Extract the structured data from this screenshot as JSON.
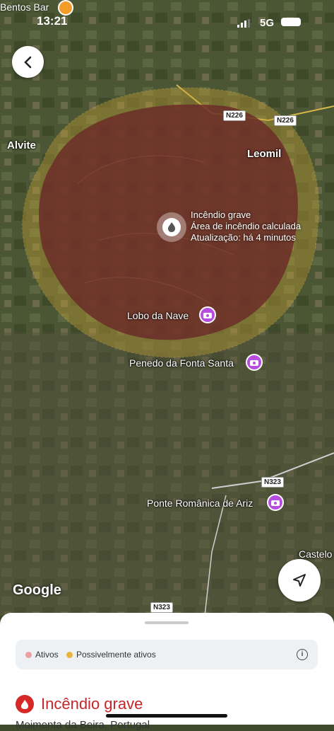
{
  "status_bar": {
    "time": "13:21",
    "network": "5G"
  },
  "top_poi": {
    "label": "Bentos Bar",
    "icon": "cocktail-icon"
  },
  "map": {
    "places": {
      "alvite": "Alvite",
      "leomil": "Leomil",
      "lobo_da_nave": "Lobo da Nave",
      "penedo": "Penedo da Fonta Santa",
      "ponte": "Ponte Românica de Ariz",
      "castelo": "Castelo"
    },
    "roads": {
      "n226_a": "N226",
      "n226_b": "N226",
      "n323_a": "N323",
      "n323_b": "N323"
    },
    "fire": {
      "title": "Incêndio grave",
      "line1": "Área de incêndio calculada",
      "line2": "Atualização: há 4 minutos"
    },
    "attribution": "Google"
  },
  "sheet": {
    "legend": {
      "active": "Ativos",
      "possibly_active": "Possivelmente ativos",
      "active_color": "#e8a0a0",
      "possible_color": "#e8b43c"
    },
    "title": "Incêndio grave",
    "subtitle": "Moimenta da Beira, Portugal"
  }
}
